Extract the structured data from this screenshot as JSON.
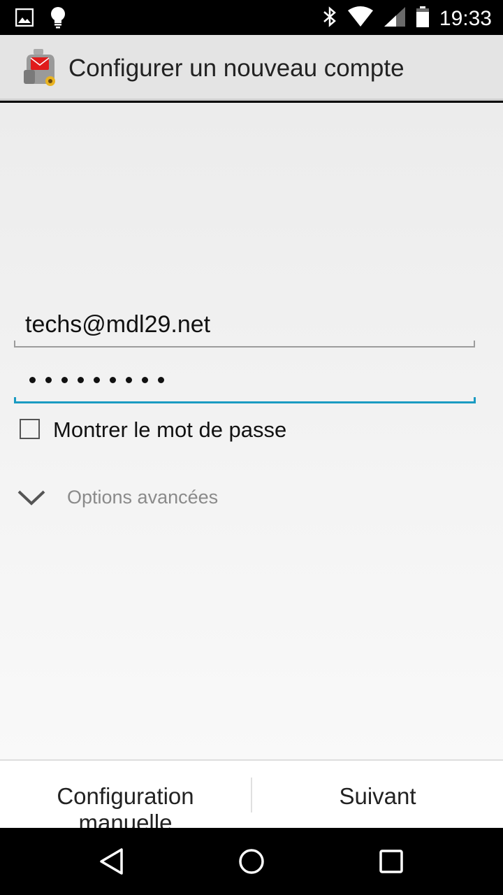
{
  "status_bar": {
    "time": "19:33",
    "left_icons": [
      "image-notification-icon",
      "lightbulb-notification-icon"
    ],
    "right_icons": [
      "bluetooth-icon",
      "wifi-icon",
      "cell-signal-icon",
      "battery-icon"
    ]
  },
  "action_bar": {
    "app_icon": "mail-app-icon",
    "title": "Configurer un nouveau compte"
  },
  "form": {
    "email_value": "techs@mdl29.net",
    "password_masked_length": 9,
    "show_password_label": "Montrer le mot de passe",
    "show_password_checked": false,
    "advanced_options_label": "Options avancées"
  },
  "buttons": {
    "manual_config_label": "Configuration manuelle",
    "next_label": "Suivant"
  },
  "nav_bar": {
    "icons": [
      "back-icon",
      "home-icon",
      "recents-icon"
    ]
  },
  "colors": {
    "accent": "#1b9bc2",
    "action_bar": "#e4e4e4"
  }
}
